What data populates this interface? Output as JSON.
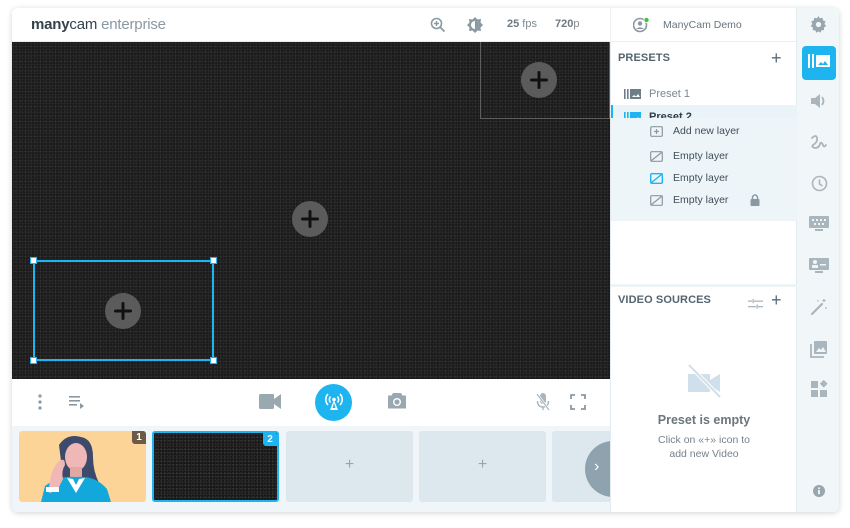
{
  "app": {
    "logo_brand_bold": "many",
    "logo_brand_light": "cam",
    "logo_suffix": " enterprise"
  },
  "topbar": {
    "fps_value": "25",
    "fps_unit": " fps",
    "resolution_value": "720",
    "resolution_unit": "p",
    "user_name": "ManyCam Demo",
    "user_status_color": "#3fc33f"
  },
  "colors": {
    "accent": "#1eb4f0",
    "rail_bg": "#f1f6f9",
    "preview_bg": "#1b1b1b"
  },
  "rail": {
    "items": [
      {
        "name": "presets",
        "icon": "presets-icon",
        "active": true
      },
      {
        "name": "audio",
        "icon": "speaker-icon",
        "active": false
      },
      {
        "name": "drawing",
        "icon": "draw-icon",
        "active": false
      },
      {
        "name": "time",
        "icon": "clock-icon",
        "active": false
      },
      {
        "name": "lower-thirds",
        "icon": "keyboard-screen-icon",
        "active": false
      },
      {
        "name": "background",
        "icon": "monitor-person-icon",
        "active": false
      },
      {
        "name": "effects",
        "icon": "magic-wand-icon",
        "active": false
      },
      {
        "name": "images",
        "icon": "image-stack-icon",
        "active": false
      },
      {
        "name": "widgets",
        "icon": "widgets-icon",
        "active": false
      }
    ],
    "info_icon": "info-icon"
  },
  "presets": {
    "title": "PRESETS",
    "add_label": "+",
    "items": [
      {
        "label": "Preset 1",
        "active": false
      },
      {
        "label": "Preset 2",
        "active": true
      }
    ],
    "layers": [
      {
        "label": "Add new layer",
        "type": "add"
      },
      {
        "label": "Empty layer",
        "type": "layer",
        "highlight": false,
        "locked": false
      },
      {
        "label": "Empty layer",
        "type": "layer",
        "highlight": true,
        "locked": false
      },
      {
        "label": "Empty layer",
        "type": "layer",
        "highlight": false,
        "locked": true
      }
    ]
  },
  "video_sources": {
    "title": "VIDEO SOURCES",
    "add_label": "+",
    "empty_title": "Preset is empty",
    "empty_line1": "Click on «+» icon to",
    "empty_line2": "add new Video"
  },
  "thumbnails": [
    {
      "number": "1",
      "type": "image",
      "badge_color": "#6b5a47"
    },
    {
      "number": "2",
      "type": "noise",
      "badge_color": "#1eb4f0",
      "selected": true
    },
    {
      "number": "",
      "type": "empty",
      "plus": "+"
    },
    {
      "number": "",
      "type": "empty",
      "plus": "+"
    },
    {
      "number": "",
      "type": "empty",
      "plus": ""
    }
  ],
  "strip_next_label": "›"
}
